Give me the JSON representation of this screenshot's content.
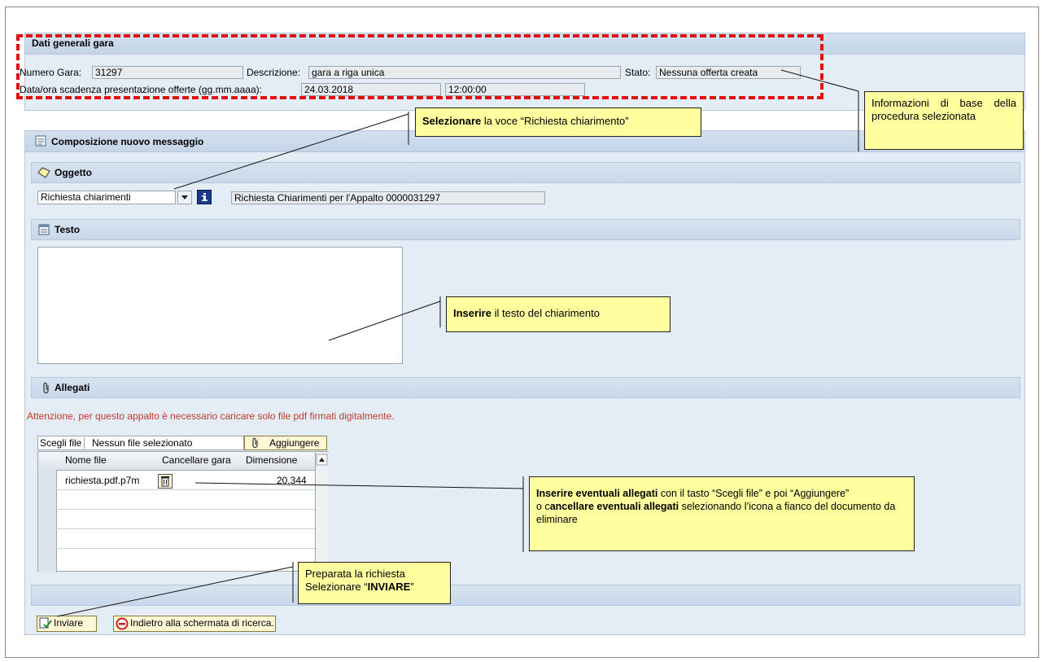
{
  "general": {
    "title": "Dati generali gara",
    "numero_label": "Numero Gara:",
    "numero_value": "31297",
    "descrizione_label": "Descrizione:",
    "descrizione_value": "gara a riga unica",
    "stato_label": "Stato:",
    "stato_value": "Nessuna offerta creata",
    "scadenza_label": "Data/ora scadenza presentazione offerte (gg.mm.aaaa):",
    "scadenza_date": "24.03.2018",
    "scadenza_time": "12:00:00"
  },
  "compose": {
    "title": "Composizione nuovo messaggio",
    "oggetto_title": "Oggetto",
    "oggetto_select": "Richiesta chiarimenti",
    "oggetto_text": "Richiesta Chiarimenti per l'Appalto 0000031297",
    "testo_title": "Testo",
    "testo_value": "",
    "allegati_title": "Allegati",
    "warning": "Attenzione, per questo appalto è necessario caricare solo file pdf firmati digitalmente.",
    "choose_file": "Scegli file",
    "no_file": "Nessun file selezionato",
    "add_button": "Aggiungere",
    "columns": [
      "Nome file",
      "Cancellare gara",
      "Dimensione"
    ],
    "rows": [
      {
        "name": "richiesta.pdf.p7m",
        "size": "20.344"
      }
    ]
  },
  "actions": {
    "send": "Inviare",
    "back": "Indietro alla schermata di ricerca."
  },
  "callouts": {
    "info_base": "Informazioni di base della procedura selezionata",
    "select_bold": "Selezionare",
    "select_rest": " la voce “Richiesta chiarimento”",
    "insert_bold": "Inserire",
    "insert_rest": " il testo del chiarimento",
    "attach_bold1": "Inserire eventuali allegati",
    "attach_rest1": " con il tasto “Scegli file” e poi “Aggiungere”",
    "attach_o": "o c",
    "attach_bold2": "ancellare eventuali allegati",
    "attach_rest2": " selezionando l’icona a fianco del documento da eliminare",
    "prep_line1": "Preparata la richiesta",
    "prep_line2_pre": "Selezionare “",
    "prep_line2_bold": "INVIARE",
    "prep_line2_post": "”"
  },
  "colors": {
    "warning_text": "#c0392b",
    "callout_bg": "#ffff9f",
    "dash_red": "#e01010",
    "panel_bg": "#e4ecf5"
  }
}
